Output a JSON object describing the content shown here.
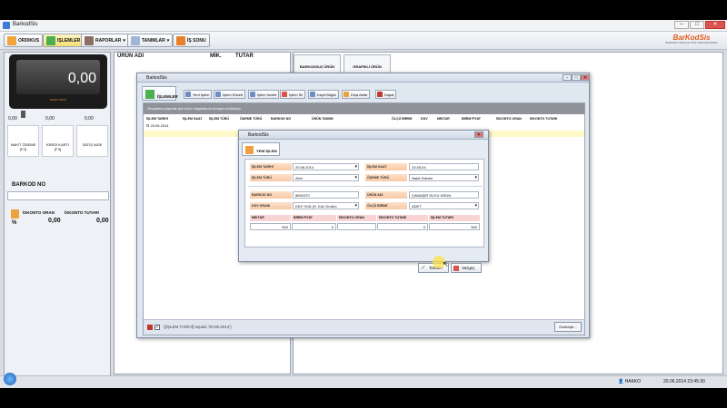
{
  "app": {
    "title": "BarkodSis",
    "logo_line1": "BarKodSis",
    "logo_line2": "BARKODLU SATIŞ VE STOK TAKİP PROGRAMI"
  },
  "toolbar": {
    "items": [
      "ORDIKUS",
      "IŞLEMLER",
      "RAPORLAR",
      "TANIMLAR",
      "İŞ SONU"
    ]
  },
  "left": {
    "display_value": "0,00",
    "display_brand": "BARKODSİS",
    "mini_values": [
      "0,00",
      "0,00",
      "0,00"
    ],
    "buttons": [
      {
        "label": "NAKİT ÖDEME",
        "key": "[F2]"
      },
      {
        "label": "KREDİ KARTI",
        "key": "[F3]"
      },
      {
        "label": "SATIŞ İADE",
        "key": ""
      }
    ],
    "barcode_label": "BARKOD NO",
    "discount_rate_label": "İSKONTO ORAN",
    "discount_total_label": "İSKONTO TUTARI",
    "discount_rate": "0,00",
    "discount_total": "0,00",
    "percent": "%"
  },
  "sale_table": {
    "columns": [
      "ÜRÜN ADI",
      "MİK.",
      "TUTAR"
    ]
  },
  "right_tabs": [
    "BARKODSUZ ÜRÜN",
    "GRAFİKLİ ÜRÜN"
  ],
  "main_window": {
    "title": "BarkodSis",
    "tab": "İŞLEMLER",
    "buttons": [
      "Yeni İşlem",
      "İşlem Düzelt",
      "İşlem İncele",
      "İşlem Sil",
      "Kayıt Bilgisi",
      "Dışa Aktar",
      "Kapat"
    ],
    "group_hint": "Gruplama yapmak için kolon başlıklarını buraya sürükleyin",
    "columns": [
      "İŞLEM TARİHİ",
      "İŞLEM SAAT",
      "İŞLEM TÜRÜ",
      "ÖDEME TÜRÜ",
      "BARKOD NO",
      "ÜRÜN TANIMI",
      "ÖLÇÜ BİRİMİ",
      "KDV",
      "MİKTAR",
      "BİRİM FİYAT",
      "İSKONTO ORAN",
      "İSKONTO TUTARI"
    ],
    "group_row": "20.06.2014",
    "filter_text": "([İŞLEM TARİHİ] equals '20.06.2014')",
    "customize_button": "Özelleştir..."
  },
  "dialog": {
    "title": "BarkodSis",
    "tab": "YENİ İŞLEM",
    "fields": {
      "date_label": "İŞLEM TARİHİ",
      "date": "20.06.2014",
      "time_label": "İŞLEM SAAT",
      "time": "23:45:24",
      "type_label": "İŞLEM TÜRÜ",
      "type": "Alım",
      "payment_label": "ÖDEME TÜRÜ",
      "payment": "Nakit Ödeme",
      "barcode_label": "BARKOD NO",
      "barcode": "8692470",
      "product_label": "ÜRÜN ADI",
      "product": "ÇAMAŞIR SUYU ÜRÜN",
      "kdv_label": "KDV ORANI",
      "kdv": "KDV %18 (G. Kdv Grubu)",
      "unit_label": "ÖLÇÜ BİRİMİ",
      "unit": "ADET"
    },
    "cols": [
      "MİKTAR",
      "BİRİM FİYAT",
      "İSKONTO ORAN",
      "İSKONTO TUTARI",
      "İŞLEM TUTARI"
    ],
    "values": [
      "500",
      "0",
      "",
      "0",
      "500"
    ],
    "ok": "Tamam",
    "cancel": "Vazgeç"
  },
  "status": {
    "user": "HAKKO",
    "datetime": "20.06.2014 23:45:30"
  },
  "colors": {
    "accent": "#ffe24a",
    "orange": "#e8802a"
  }
}
